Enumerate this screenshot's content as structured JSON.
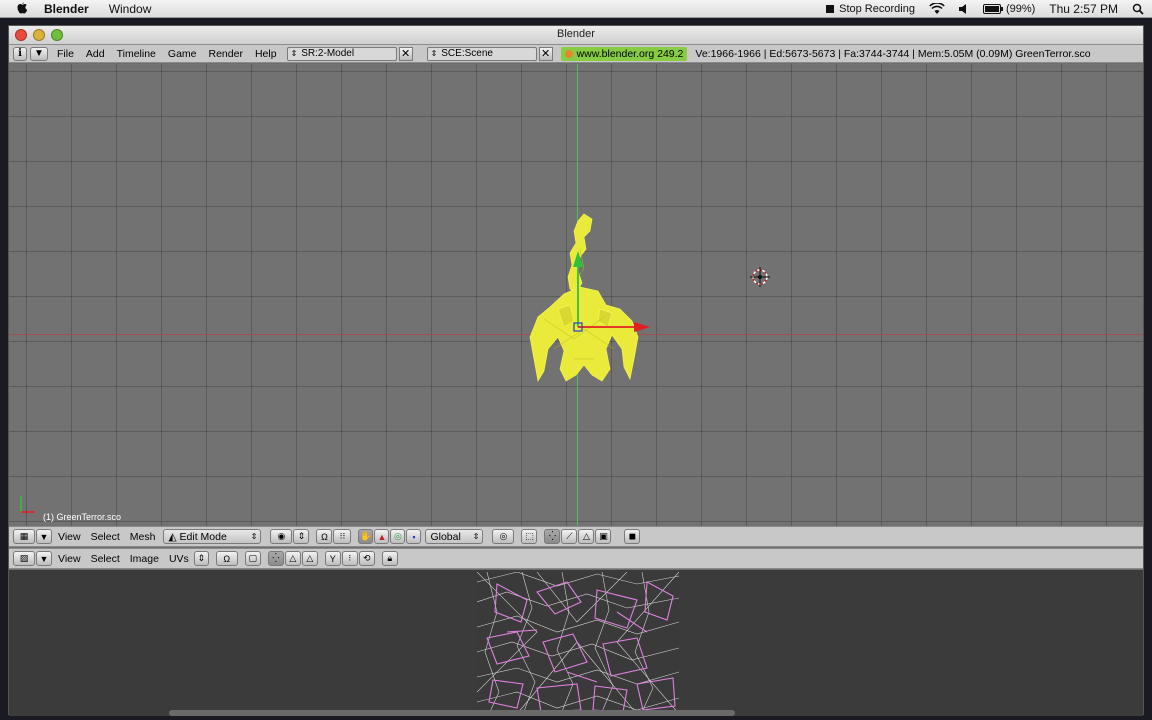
{
  "macbar": {
    "app_name": "Blender",
    "menus": [
      "Window"
    ],
    "stop_recording": "Stop Recording",
    "battery": "(99%)",
    "clock": "Thu 2:57 PM"
  },
  "window": {
    "title": "Blender"
  },
  "header": {
    "menus": [
      "File",
      "Add",
      "Timeline",
      "Game",
      "Render",
      "Help"
    ],
    "screen": "SR:2-Model",
    "scene": "SCE:Scene",
    "link": "www.blender.org 249.2",
    "stats": "Ve:1966-1966 | Ed:5673-5673 | Fa:3744-3744 | Mem:5.05M (0.09M) GreenTerror.sco"
  },
  "viewport": {
    "object_label": "(1) GreenTerror.sco"
  },
  "toolbar3d": {
    "menus": [
      "View",
      "Select",
      "Mesh"
    ],
    "mode": "Edit Mode",
    "orientation": "Global"
  },
  "toolbar_uv": {
    "menus": [
      "View",
      "Select",
      "Image",
      "UVs"
    ]
  },
  "colors": {
    "mesh": "#f0f040",
    "uv_wire": "#e080e0",
    "link_bg": "#88cc44"
  }
}
